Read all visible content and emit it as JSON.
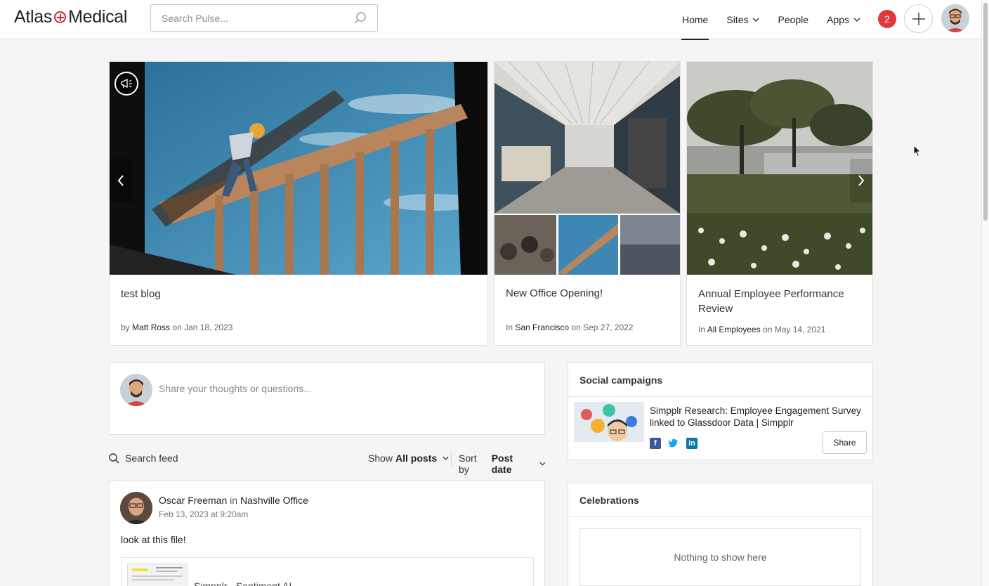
{
  "brand": {
    "name_part1": "Atlas",
    "name_part2": "Medical",
    "accent": "#d9232e"
  },
  "search": {
    "placeholder": "Search Pulse..."
  },
  "nav": {
    "items": [
      {
        "label": "Home",
        "active": true
      },
      {
        "label": "Sites",
        "dropdown": true
      },
      {
        "label": "People"
      },
      {
        "label": "Apps",
        "dropdown": true
      }
    ],
    "notifications": "2"
  },
  "carousel": {
    "cards": [
      {
        "title": "test blog",
        "meta_prefix": "by",
        "meta_link": "Matt Ross",
        "meta_suffix": "on Jan 18, 2023"
      },
      {
        "title": "New Office Opening!",
        "meta_prefix": "In",
        "meta_link": "San Francisco",
        "meta_suffix": "on Sep 27, 2022"
      },
      {
        "title": "Annual Employee Performance Review",
        "meta_prefix": "In",
        "meta_link": "All Employees",
        "meta_suffix": "on May 14, 2021"
      }
    ]
  },
  "composer": {
    "placeholder": "Share your thoughts or questions..."
  },
  "feed": {
    "search_label": "Search feed",
    "show_label": "Show",
    "show_value": "All posts",
    "sort_label": "Sort by",
    "sort_value": "Post date",
    "post": {
      "author": "Oscar Freeman",
      "in_word": "in",
      "location": "Nashville Office",
      "time": "Feb 13, 2023 at 9:20am",
      "body": "look at this file!",
      "attachment_name": "Simpplr - Sentiment AI..."
    }
  },
  "social_campaigns": {
    "title": "Social campaigns",
    "campaign_title": "Simpplr Research: Employee Engagement Survey linked to Glassdoor Data | Simpplr",
    "share_label": "Share",
    "networks": [
      "facebook-icon",
      "twitter-icon",
      "linkedin-icon"
    ]
  },
  "celebrations": {
    "title": "Celebrations",
    "empty_text": "Nothing to show here"
  }
}
